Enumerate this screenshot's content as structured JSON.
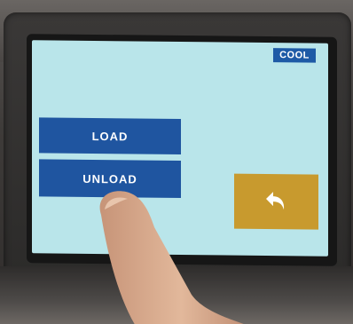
{
  "screen": {
    "mode_badge": "COOL",
    "menu": {
      "load_label": "LOAD",
      "unload_label": "UNLOAD"
    },
    "back_icon": "back-arrow-icon"
  },
  "colors": {
    "screen_background": "#b9e5ea",
    "menu_button": "#1f55a0",
    "badge": "#1e5aa6",
    "back_button": "#c89a2e"
  }
}
